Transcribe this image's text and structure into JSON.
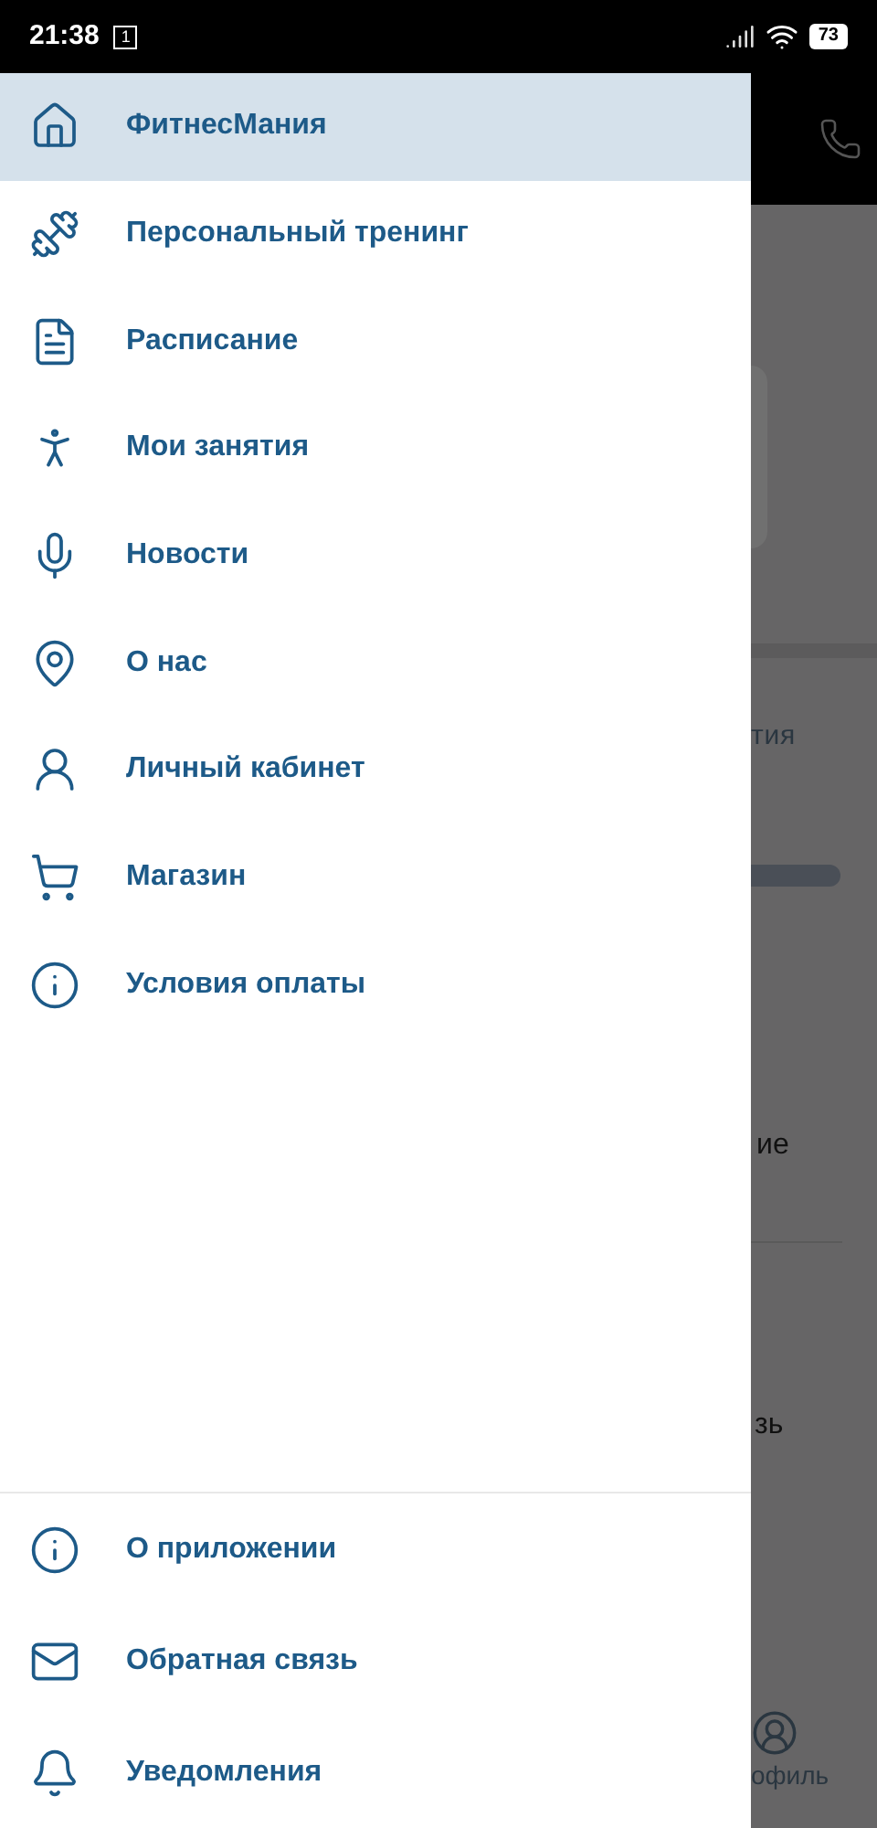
{
  "status_bar": {
    "time": "21:38",
    "notification": "1",
    "battery": "73"
  },
  "drawer": {
    "items": [
      {
        "label": "ФитнесМания",
        "kind": "home",
        "selected": true
      },
      {
        "label": "Персональный тренинг",
        "kind": "dumbbell",
        "selected": false
      },
      {
        "label": "Расписание",
        "kind": "document",
        "selected": false
      },
      {
        "label": "Мои занятия",
        "kind": "runner",
        "selected": false
      },
      {
        "label": "Новости",
        "kind": "microphone",
        "selected": false
      },
      {
        "label": "О нас",
        "kind": "pin",
        "selected": false
      },
      {
        "label": "Личный кабинет",
        "kind": "person",
        "selected": false
      },
      {
        "label": "Магазин",
        "kind": "cart",
        "selected": false
      },
      {
        "label": "Условия оплаты",
        "kind": "info",
        "selected": false
      }
    ],
    "footer_items": [
      {
        "label": "О приложении",
        "kind": "info",
        "selected": false
      },
      {
        "label": "Обратная связь",
        "kind": "mail",
        "selected": false
      },
      {
        "label": "Уведомления",
        "kind": "bell",
        "selected": false
      }
    ]
  },
  "background": {
    "heading_fragment": "тия",
    "text_fragment_1": "ие",
    "text_fragment_2": "зь",
    "tab_fragment": "офиль"
  }
}
